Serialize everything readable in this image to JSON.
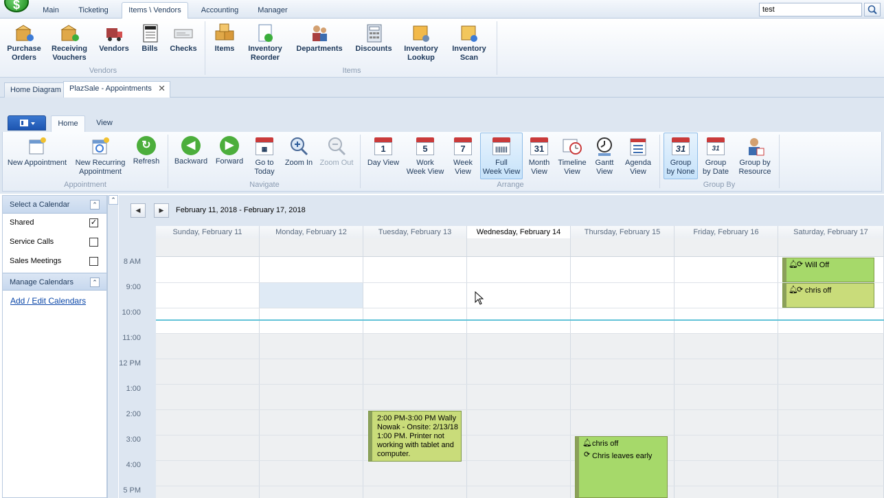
{
  "main_tabs": [
    "Main",
    "Ticketing",
    "Items \\ Vendors",
    "Accounting",
    "Manager"
  ],
  "active_main_tab": "Items \\ Vendors",
  "search": {
    "value": "test"
  },
  "ribbon_vendors": {
    "group_label": "Vendors",
    "buttons": [
      {
        "line1": "Purchase",
        "line2": "Orders"
      },
      {
        "line1": "Receiving",
        "line2": "Vouchers"
      },
      {
        "line1": "Vendors",
        "line2": ""
      },
      {
        "line1": "Bills",
        "line2": ""
      },
      {
        "line1": "Checks",
        "line2": ""
      }
    ]
  },
  "ribbon_items": {
    "group_label": "Items",
    "buttons": [
      {
        "line1": "Items",
        "line2": ""
      },
      {
        "line1": "Inventory",
        "line2": "Reorder"
      },
      {
        "line1": "Departments",
        "line2": ""
      },
      {
        "line1": "Discounts",
        "line2": ""
      },
      {
        "line1": "Inventory",
        "line2": "Lookup"
      },
      {
        "line1": "Inventory",
        "line2": "Scan"
      }
    ]
  },
  "doc_tabs": [
    "Home Diagram",
    "PlazSale - Appointments"
  ],
  "sub_tabs": [
    "Home",
    "View"
  ],
  "appointment_group": {
    "label": "Appointment",
    "buttons": [
      {
        "line1": "New Appointment",
        "line2": ""
      },
      {
        "line1": "New Recurring",
        "line2": "Appointment"
      },
      {
        "line1": "Refresh",
        "line2": ""
      }
    ]
  },
  "navigate_group": {
    "label": "Navigate",
    "buttons": [
      {
        "line1": "Backward",
        "line2": ""
      },
      {
        "line1": "Forward",
        "line2": ""
      },
      {
        "line1": "Go to",
        "line2": "Today"
      },
      {
        "line1": "Zoom In",
        "line2": ""
      },
      {
        "line1": "Zoom Out",
        "line2": ""
      }
    ]
  },
  "arrange_group": {
    "label": "Arrange",
    "buttons": [
      {
        "line1": "Day View",
        "line2": "",
        "num": "1"
      },
      {
        "line1": "Work",
        "line2": "Week View",
        "num": "5"
      },
      {
        "line1": "Week",
        "line2": "View",
        "num": "7"
      },
      {
        "line1": "Full",
        "line2": "Week View",
        "num": ""
      },
      {
        "line1": "Month",
        "line2": "View",
        "num": "31"
      },
      {
        "line1": "Timeline",
        "line2": "View",
        "num": ""
      },
      {
        "line1": "Gantt",
        "line2": "View",
        "num": ""
      },
      {
        "line1": "Agenda",
        "line2": "View",
        "num": ""
      }
    ]
  },
  "groupby_group": {
    "label": "Group By",
    "buttons": [
      {
        "line1": "Group",
        "line2": "by None",
        "num": "31"
      },
      {
        "line1": "Group",
        "line2": "by Date",
        "num": "31"
      },
      {
        "line1": "Group by",
        "line2": "Resource",
        "num": ""
      }
    ]
  },
  "left_panel": {
    "select_header": "Select a Calendar",
    "calendars": [
      {
        "name": "Shared",
        "checked": true,
        "mark": "✓"
      },
      {
        "name": "Service Calls",
        "checked": false,
        "mark": ""
      },
      {
        "name": "Sales Meetings",
        "checked": false,
        "mark": ""
      }
    ],
    "manage_header": "Manage Calendars",
    "add_edit_link": "Add / Edit Calendars"
  },
  "calendar": {
    "date_range": "February 11, 2018 - February 17, 2018",
    "days": [
      "Sunday, February 11",
      "Monday, February 12",
      "Tuesday, February 13",
      "Wednesday, February 14",
      "Thursday, February 15",
      "Friday, February 16",
      "Saturday, February 17"
    ],
    "today_index": 3,
    "times": [
      "8 AM",
      "9:00",
      "10:00",
      "11:00",
      "12 PM",
      "1:00",
      "2:00",
      "3:00",
      "4:00",
      "5 PM"
    ],
    "appointments": [
      {
        "text": "Will Off",
        "day": 6,
        "start": "8:00",
        "end": "9:00"
      },
      {
        "text": "chris off",
        "day": 6,
        "start": "9:00",
        "end": "10:00"
      },
      {
        "text": "2:00 PM-3:00 PM Wally Nowak - Onsite: 2/13/18 1:00 PM. Printer not working with tablet and computer.",
        "day": 2,
        "start": "14:00",
        "end": "16:00"
      },
      {
        "text": "chris off",
        "day": 4,
        "start": "15:00",
        "end": "17:00"
      },
      {
        "text": "Chris leaves early",
        "day": 4,
        "start": "15:00",
        "end": "17:00"
      }
    ]
  },
  "colors": {
    "accent": "#1d55b0",
    "appointment_green": "#c9dc7a",
    "appointment_light_green": "#a6d96a",
    "now_line": "#62c3d8"
  }
}
